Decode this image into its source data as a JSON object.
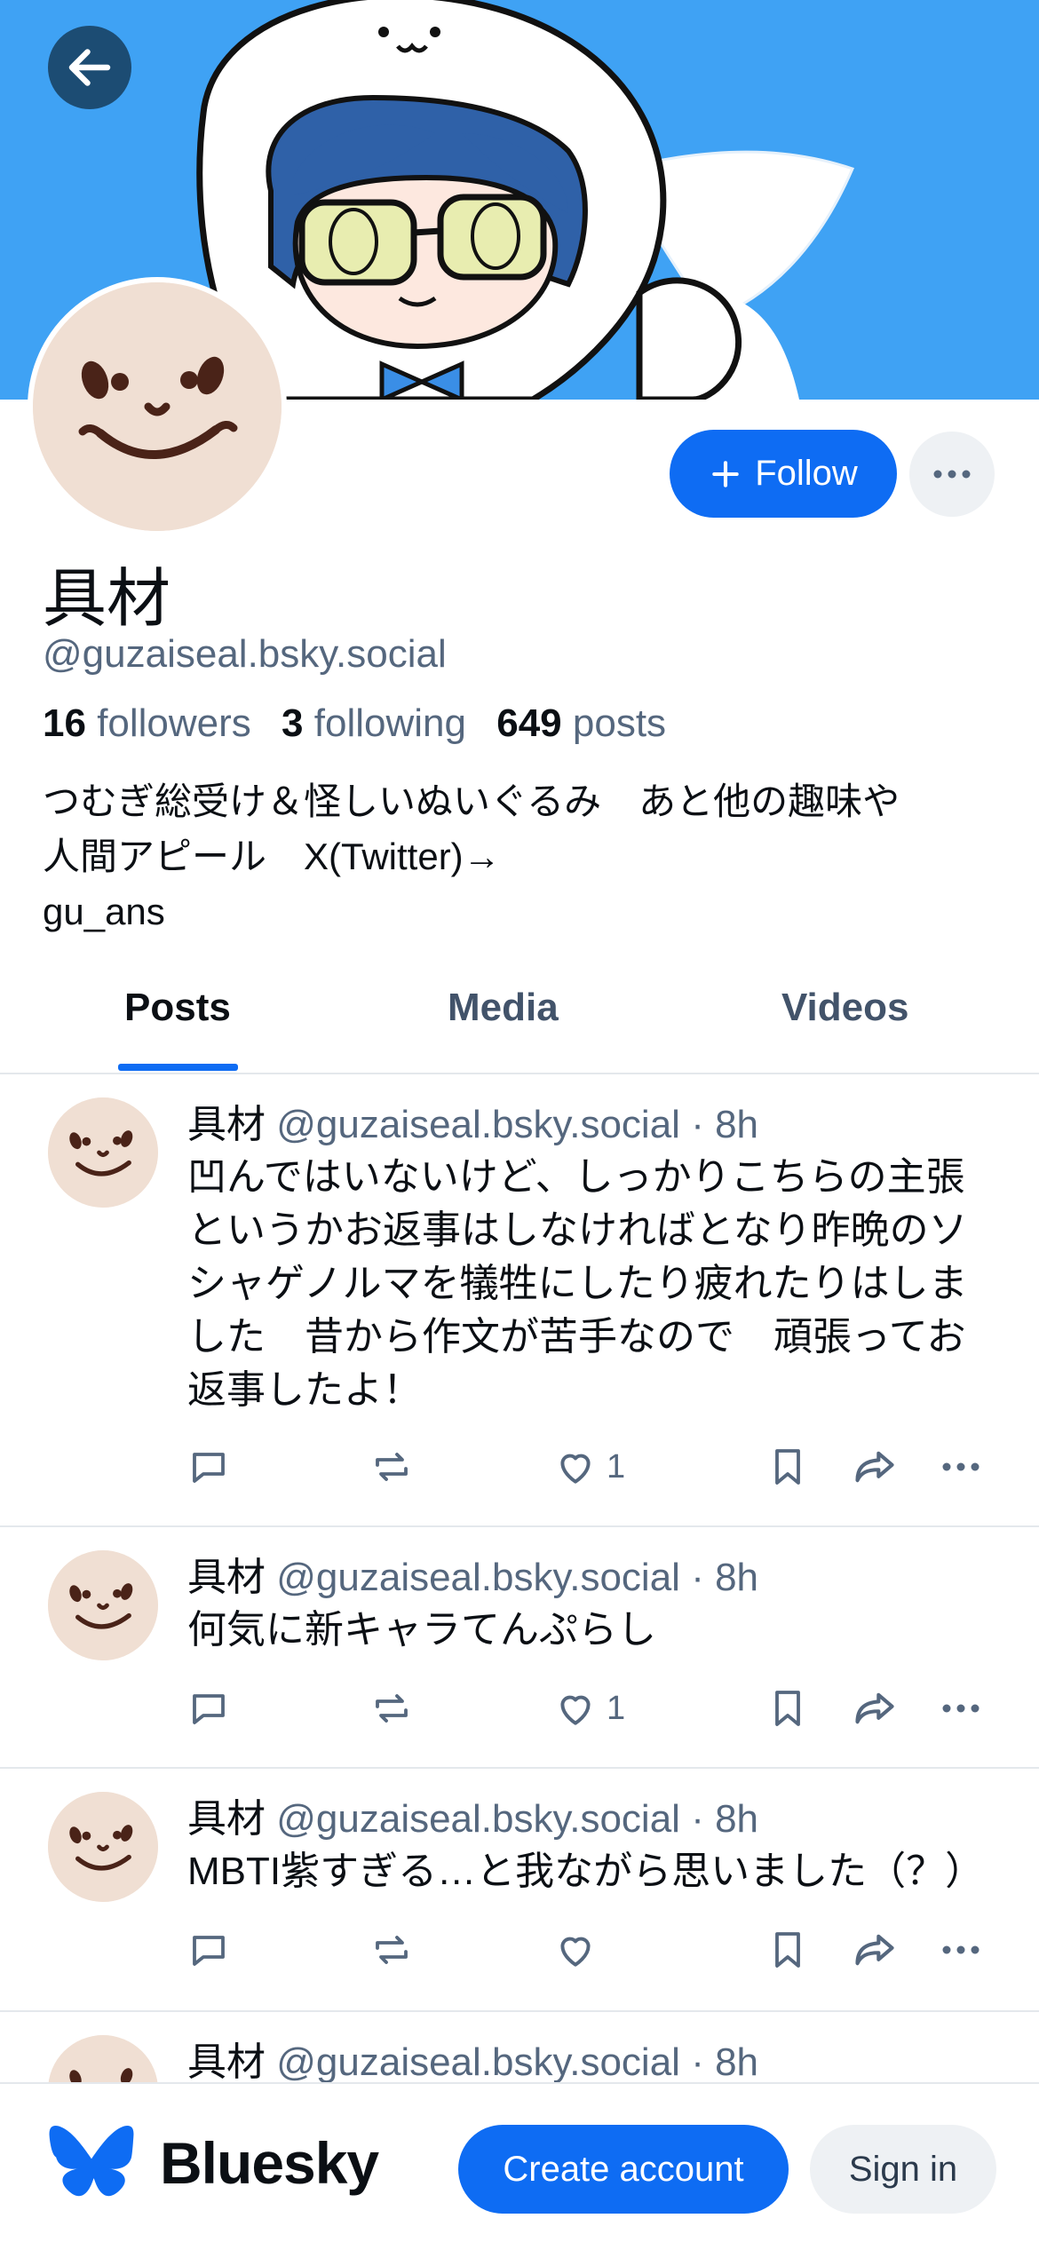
{
  "colors": {
    "banner": "#3fa2f4",
    "accent": "#0e6cf3",
    "muted": "#55677e",
    "divider": "#e4e8ec"
  },
  "header": {
    "back_icon": "arrow-left-icon"
  },
  "profile": {
    "display_name": "具材",
    "handle": "@guzaiseal.bsky.social",
    "followers_count": "16",
    "followers_label": "followers",
    "following_count": "3",
    "following_label": "following",
    "posts_count": "649",
    "posts_label": "posts",
    "bio_lines": [
      "つむぎ総受け＆怪しいぬいぐるみ　あと他の趣味や",
      "人間アピール　X(Twitter)→",
      "gu_ans"
    ],
    "follow_label": "Follow",
    "more_icon": "more-horizontal-icon"
  },
  "tabs": [
    {
      "label": "Posts",
      "active": true
    },
    {
      "label": "Media",
      "active": false
    },
    {
      "label": "Videos",
      "active": false
    }
  ],
  "posts": [
    {
      "author": "具材",
      "handle": "@guzaiseal.bsky.social",
      "time": "8h",
      "text": "凹んではいないけど、しっかりこちらの主張というかお返事はしなければとなり昨晩のソシャゲノルマを犠牲にしたり疲れたりはしました　昔から作文が苦手なので　頑張ってお返事したよ！",
      "likes": "1"
    },
    {
      "author": "具材",
      "handle": "@guzaiseal.bsky.social",
      "time": "8h",
      "text": "何気に新キャラてんぷらし",
      "likes": "1"
    },
    {
      "author": "具材",
      "handle": "@guzaiseal.bsky.social",
      "time": "8h",
      "text": "MBTI紫すぎる…と我ながら思いました（？）",
      "likes": ""
    },
    {
      "author": "具材",
      "handle": "@guzaiseal.bsky.social",
      "time": "8h",
      "text": "",
      "likes": ""
    }
  ],
  "footer": {
    "brand": "Bluesky",
    "create_account_label": "Create account",
    "sign_in_label": "Sign in"
  }
}
